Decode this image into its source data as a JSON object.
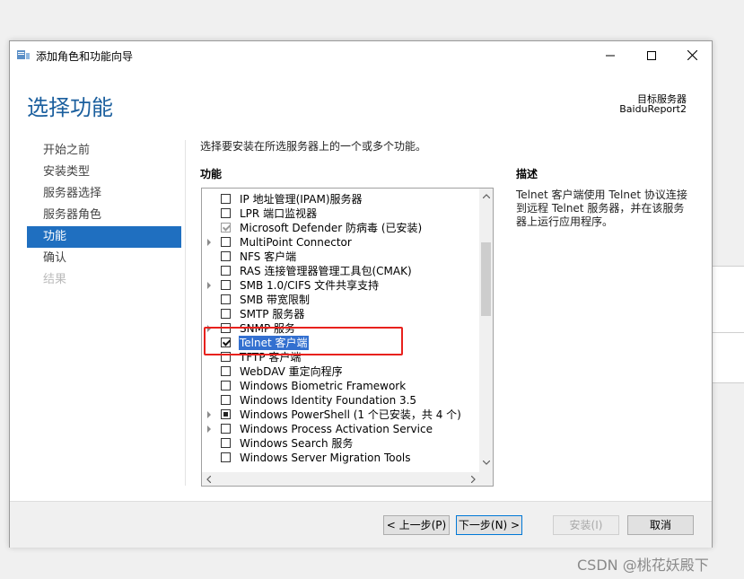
{
  "window": {
    "title": "添加角色和功能向导",
    "controls": {
      "minimize": "—",
      "maximize": "☐",
      "close": "✕"
    }
  },
  "page_title": "选择功能",
  "target": {
    "label": "目标服务器",
    "value": "BaiduReport2"
  },
  "nav": {
    "items": [
      {
        "label": "开始之前",
        "state": "normal"
      },
      {
        "label": "安装类型",
        "state": "normal"
      },
      {
        "label": "服务器选择",
        "state": "normal"
      },
      {
        "label": "服务器角色",
        "state": "normal"
      },
      {
        "label": "功能",
        "state": "active"
      },
      {
        "label": "确认",
        "state": "normal"
      },
      {
        "label": "结果",
        "state": "disabled"
      }
    ]
  },
  "instruction": "选择要安装在所选服务器上的一个或多个功能。",
  "features": {
    "header": "功能",
    "items": [
      {
        "label": "IP 地址管理(IPAM)服务器",
        "state": "unchecked",
        "expandable": false,
        "selected": false
      },
      {
        "label": "LPR 端口监视器",
        "state": "unchecked",
        "expandable": false,
        "selected": false
      },
      {
        "label": "Microsoft Defender 防病毒 (已安装)",
        "state": "checked-disabled",
        "expandable": false,
        "selected": false
      },
      {
        "label": "MultiPoint Connector",
        "state": "unchecked",
        "expandable": true,
        "selected": false
      },
      {
        "label": "NFS 客户端",
        "state": "unchecked",
        "expandable": false,
        "selected": false
      },
      {
        "label": "RAS 连接管理器管理工具包(CMAK)",
        "state": "unchecked",
        "expandable": false,
        "selected": false
      },
      {
        "label": "SMB 1.0/CIFS 文件共享支持",
        "state": "unchecked",
        "expandable": true,
        "selected": false
      },
      {
        "label": "SMB 带宽限制",
        "state": "unchecked",
        "expandable": false,
        "selected": false
      },
      {
        "label": "SMTP 服务器",
        "state": "unchecked",
        "expandable": false,
        "selected": false
      },
      {
        "label": "SNMP 服务",
        "state": "unchecked",
        "expandable": true,
        "selected": false
      },
      {
        "label": "Telnet 客户端",
        "state": "checked",
        "expandable": false,
        "selected": true
      },
      {
        "label": "TFTP 客户端",
        "state": "unchecked",
        "expandable": false,
        "selected": false
      },
      {
        "label": "WebDAV 重定向程序",
        "state": "unchecked",
        "expandable": false,
        "selected": false
      },
      {
        "label": "Windows Biometric Framework",
        "state": "unchecked",
        "expandable": false,
        "selected": false
      },
      {
        "label": "Windows Identity Foundation 3.5",
        "state": "unchecked",
        "expandable": false,
        "selected": false
      },
      {
        "label": "Windows PowerShell (1 个已安装，共 4 个)",
        "state": "partial",
        "expandable": true,
        "selected": false
      },
      {
        "label": "Windows Process Activation Service",
        "state": "unchecked",
        "expandable": true,
        "selected": false
      },
      {
        "label": "Windows Search 服务",
        "state": "unchecked",
        "expandable": false,
        "selected": false
      },
      {
        "label": "Windows Server Migration Tools",
        "state": "unchecked",
        "expandable": false,
        "selected": false
      }
    ]
  },
  "description": {
    "header": "描述",
    "text": "Telnet 客户端使用 Telnet 协议连接到远程 Telnet 服务器，并在该服务器上运行应用程序。"
  },
  "buttons": {
    "prev": "< 上一步(P)",
    "next": "下一步(N) >",
    "install": "安装(I)",
    "cancel": "取消"
  },
  "watermark": "CSDN @桃花妖殿下",
  "colors": {
    "accent": "#1f6fc0",
    "title": "#1b5f9e",
    "highlight_box": "#e8211d"
  }
}
